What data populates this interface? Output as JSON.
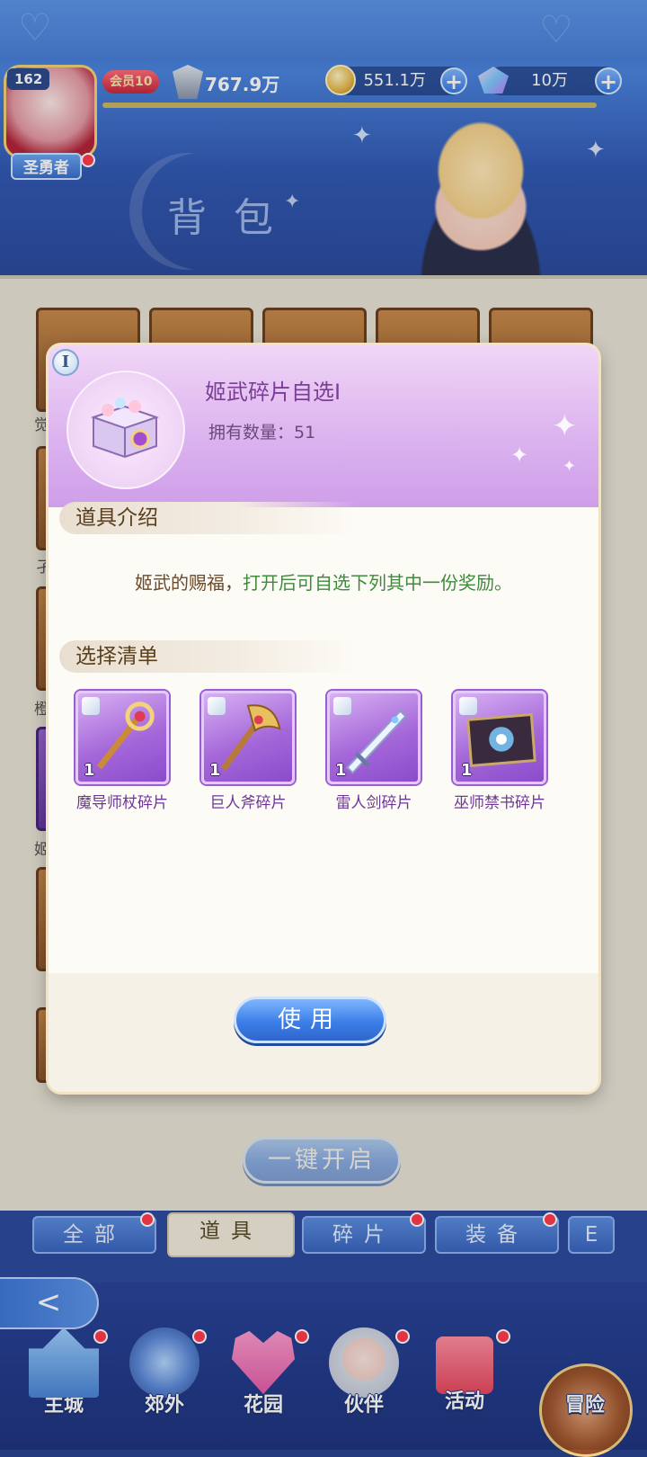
{
  "header": {
    "level": "162",
    "vip": "会员10",
    "power": "767.9万",
    "gold": "551.1万",
    "gems": "10万",
    "player_title": "圣勇者",
    "plus": "+"
  },
  "page": {
    "title": "背包"
  },
  "bag": {
    "open_all_label": "一键开启",
    "side_labels": [
      "觉",
      "孑",
      "橙",
      "姬"
    ]
  },
  "tabs": [
    {
      "label": "全部"
    },
    {
      "label": "道具"
    },
    {
      "label": "碎片"
    },
    {
      "label": "装备"
    },
    {
      "label": "E"
    }
  ],
  "nav": [
    {
      "label": "主城",
      "icon": "castle-icon"
    },
    {
      "label": "郊外",
      "icon": "portal-icon"
    },
    {
      "label": "花园",
      "icon": "heart-icon"
    },
    {
      "label": "伙伴",
      "icon": "partner-icon"
    },
    {
      "label": "活动",
      "icon": "gift-icon"
    },
    {
      "label": "冒险",
      "icon": "sword-icon"
    }
  ],
  "back_glyph": "<",
  "modal": {
    "info_badge": "I",
    "item_name": "姬武碎片自选I",
    "owned_label": "拥有数量：",
    "owned_count": "51",
    "intro_title": "道具介绍",
    "desc_part1": "姬武的赐福，",
    "desc_part2": "打开后可自选下列其中一份奖励。",
    "choice_title": "选择清单",
    "rewards": [
      {
        "name": "魔导师杖碎片",
        "count": "1",
        "icon": "staff-icon"
      },
      {
        "name": "巨人斧碎片",
        "count": "1",
        "icon": "axe-icon"
      },
      {
        "name": "雷人剑碎片",
        "count": "1",
        "icon": "sword-icon"
      },
      {
        "name": "巫师禁书碎片",
        "count": "1",
        "icon": "book-icon"
      }
    ],
    "use_label": "使用"
  },
  "colors": {
    "modal_header": "#dcb4ef",
    "desc_highlight": "#3f8a3c",
    "button_blue": "#3c7fe8"
  }
}
